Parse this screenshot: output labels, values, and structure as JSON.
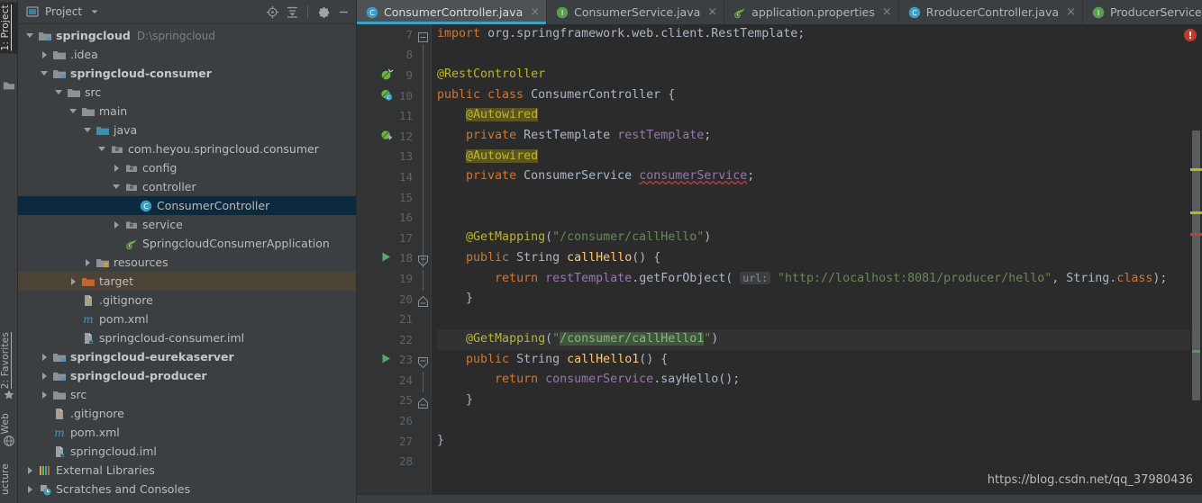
{
  "toolstrip": {
    "tabs": [
      {
        "id": "project",
        "label": "1: Project",
        "active": true
      },
      {
        "id": "favorites",
        "label": "2: Favorites",
        "active": false
      },
      {
        "id": "web",
        "label": "Web",
        "active": false
      },
      {
        "id": "structure",
        "label": "ucture",
        "active": false
      }
    ]
  },
  "project_panel": {
    "title": "Project",
    "icons": {
      "view_mode": "project-view-icon",
      "dropdown": "chevron-down-icon",
      "locate": "scroll-from-source-icon",
      "collapse": "collapse-all-icon",
      "settings": "gear-icon",
      "hide": "minimize-icon"
    },
    "tree": [
      {
        "depth": 0,
        "arrow": "open",
        "icon": "module-folder",
        "label": "springcloud",
        "bold": true,
        "sub": "D:\\springcloud"
      },
      {
        "depth": 1,
        "arrow": "closed",
        "icon": "folder",
        "label": ".idea",
        "bold": false,
        "sub": ""
      },
      {
        "depth": 1,
        "arrow": "open",
        "icon": "module-folder",
        "label": "springcloud-consumer",
        "bold": true,
        "sub": ""
      },
      {
        "depth": 2,
        "arrow": "open",
        "icon": "folder",
        "label": "src",
        "bold": false,
        "sub": ""
      },
      {
        "depth": 3,
        "arrow": "open",
        "icon": "folder",
        "label": "main",
        "bold": false,
        "sub": ""
      },
      {
        "depth": 4,
        "arrow": "open",
        "icon": "source-folder",
        "label": "java",
        "bold": false,
        "sub": ""
      },
      {
        "depth": 5,
        "arrow": "open",
        "icon": "package",
        "label": "com.heyou.springcloud.consumer",
        "bold": false,
        "sub": ""
      },
      {
        "depth": 6,
        "arrow": "closed",
        "icon": "package",
        "label": "config",
        "bold": false,
        "sub": ""
      },
      {
        "depth": 6,
        "arrow": "open",
        "icon": "package",
        "label": "controller",
        "bold": false,
        "sub": ""
      },
      {
        "depth": 7,
        "arrow": "none",
        "icon": "java-class",
        "label": "ConsumerController",
        "bold": false,
        "sub": "",
        "selected": true
      },
      {
        "depth": 6,
        "arrow": "closed",
        "icon": "package",
        "label": "service",
        "bold": false,
        "sub": ""
      },
      {
        "depth": 6,
        "arrow": "none",
        "icon": "spring-boot",
        "label": "SpringcloudConsumerApplication",
        "bold": false,
        "sub": ""
      },
      {
        "depth": 4,
        "arrow": "closed",
        "icon": "resource-folder",
        "label": "resources",
        "bold": false,
        "sub": ""
      },
      {
        "depth": 3,
        "arrow": "closed",
        "icon": "target-folder",
        "label": "target",
        "bold": false,
        "sub": "",
        "target": true
      },
      {
        "depth": 3,
        "arrow": "none",
        "icon": "gitignore-file",
        "label": ".gitignore",
        "bold": false,
        "sub": ""
      },
      {
        "depth": 3,
        "arrow": "none",
        "icon": "maven-file",
        "label": "pom.xml",
        "bold": false,
        "sub": ""
      },
      {
        "depth": 3,
        "arrow": "none",
        "icon": "iml-file",
        "label": "springcloud-consumer.iml",
        "bold": false,
        "sub": ""
      },
      {
        "depth": 1,
        "arrow": "closed",
        "icon": "module-folder",
        "label": "springcloud-eurekaserver",
        "bold": true,
        "sub": ""
      },
      {
        "depth": 1,
        "arrow": "closed",
        "icon": "module-folder",
        "label": "springcloud-producer",
        "bold": true,
        "sub": ""
      },
      {
        "depth": 1,
        "arrow": "closed",
        "icon": "folder",
        "label": "src",
        "bold": false,
        "sub": ""
      },
      {
        "depth": 1,
        "arrow": "none",
        "icon": "gitignore-file",
        "label": ".gitignore",
        "bold": false,
        "sub": ""
      },
      {
        "depth": 1,
        "arrow": "none",
        "icon": "maven-file",
        "label": "pom.xml",
        "bold": false,
        "sub": ""
      },
      {
        "depth": 1,
        "arrow": "none",
        "icon": "iml-file",
        "label": "springcloud.iml",
        "bold": false,
        "sub": ""
      },
      {
        "depth": 0,
        "arrow": "closed",
        "icon": "libraries",
        "label": "External Libraries",
        "bold": false,
        "sub": ""
      },
      {
        "depth": 0,
        "arrow": "closed",
        "icon": "scratches",
        "label": "Scratches and Consoles",
        "bold": false,
        "sub": ""
      }
    ]
  },
  "editor": {
    "tabs": [
      {
        "label": "ConsumerController.java",
        "icon": "java-class-icon",
        "active": true,
        "close": "×"
      },
      {
        "label": "ConsumerService.java",
        "icon": "java-interface-icon",
        "active": false,
        "close": "×"
      },
      {
        "label": "application.properties",
        "icon": "spring-boot-icon",
        "active": false,
        "close": "×"
      },
      {
        "label": "RroducerController.java",
        "icon": "java-class-icon",
        "active": false,
        "close": "×"
      },
      {
        "label": "ProducerService.java",
        "icon": "java-interface-icon",
        "active": false,
        "close": "×"
      }
    ],
    "tabbar_right_icon": "tab-list-dropdown-icon",
    "error_badge": "!",
    "first_line_number": 7,
    "lines": [
      {
        "n": 7,
        "gutter": "fold-collapse",
        "text": "import org.springframework.web.client.RestTemplate;"
      },
      {
        "n": 8,
        "gutter": "",
        "text": ""
      },
      {
        "n": 9,
        "gutter": "spring-bean-icon",
        "text": "@RestController"
      },
      {
        "n": 10,
        "gutter": "spring-bean-class-icon",
        "text": "public class ConsumerController {"
      },
      {
        "n": 11,
        "gutter": "",
        "text": "    @Autowired"
      },
      {
        "n": 12,
        "gutter": "spring-autowire-icon",
        "text": "    private RestTemplate restTemplate;"
      },
      {
        "n": 13,
        "gutter": "",
        "text": "    @Autowired"
      },
      {
        "n": 14,
        "gutter": "",
        "text": "    private ConsumerService consumerService;"
      },
      {
        "n": 15,
        "gutter": "",
        "text": ""
      },
      {
        "n": 16,
        "gutter": "",
        "text": ""
      },
      {
        "n": 17,
        "gutter": "",
        "text": "    @GetMapping(\"/consumer/callHello\")"
      },
      {
        "n": 18,
        "gutter": "run-gutter-icon",
        "text": "    public String callHello() {"
      },
      {
        "n": 19,
        "gutter": "",
        "text": "        return restTemplate.getForObject( url: \"http://localhost:8081/producer/hello\", String.class);"
      },
      {
        "n": 20,
        "gutter": "",
        "text": "    }"
      },
      {
        "n": 21,
        "gutter": "",
        "text": ""
      },
      {
        "n": 22,
        "gutter": "",
        "text": "    @GetMapping(\"/consumer/callHello1\")"
      },
      {
        "n": 23,
        "gutter": "run-gutter-icon",
        "text": "    public String callHello1() {"
      },
      {
        "n": 24,
        "gutter": "",
        "text": "        return consumerService.sayHello();"
      },
      {
        "n": 25,
        "gutter": "",
        "text": "    }"
      },
      {
        "n": 26,
        "gutter": "",
        "text": ""
      },
      {
        "n": 27,
        "gutter": "",
        "text": "}"
      },
      {
        "n": 28,
        "gutter": "",
        "text": ""
      }
    ],
    "inlay_hints": [
      {
        "line": 19,
        "text": "url:"
      }
    ],
    "scrollbar_markers": [
      {
        "type": "warning",
        "color": "#bbb529"
      },
      {
        "type": "warning",
        "color": "#bbb529"
      },
      {
        "type": "error",
        "color": "#bc3f3c"
      },
      {
        "type": "change",
        "color": "#4c9e4c"
      }
    ],
    "watermark": "https://blog.csdn.net/qq_37980436"
  },
  "colors": {
    "accent": "#3ca1c4",
    "selection": "#0d293e",
    "target_row": "#4a4336",
    "keyword": "#cc7832",
    "string": "#6a8759",
    "annotation": "#bbb529",
    "field": "#9876aa",
    "method": "#ffc66d",
    "error": "#bc3f3c"
  }
}
